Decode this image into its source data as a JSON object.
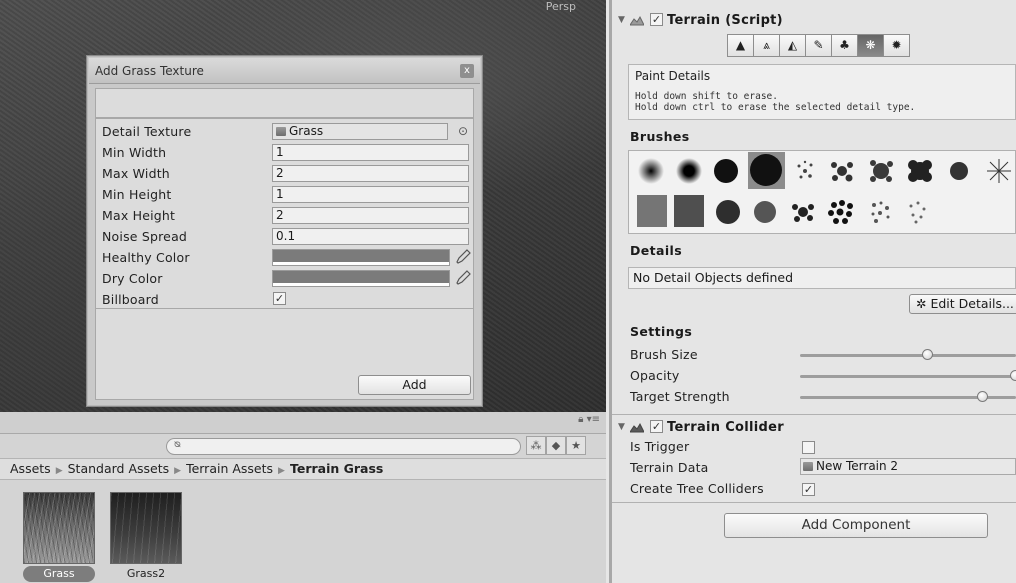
{
  "scene": {
    "view_label": "Persp"
  },
  "dialog": {
    "title": "Add Grass Texture",
    "close_glyph": "x",
    "fields": [
      {
        "label": "Detail Texture",
        "value": "Grass"
      },
      {
        "label": "Min Width",
        "value": "1"
      },
      {
        "label": "Max Width",
        "value": "2"
      },
      {
        "label": "Min Height",
        "value": "1"
      },
      {
        "label": "Max Height",
        "value": "2"
      },
      {
        "label": "Noise Spread",
        "value": "0.1"
      },
      {
        "label": "Healthy Color"
      },
      {
        "label": "Dry Color"
      },
      {
        "label": "Billboard",
        "checked": true
      }
    ],
    "add_label": "Add"
  },
  "project": {
    "breadcrumb": [
      "Assets",
      "Standard Assets",
      "Terrain Assets",
      "Terrain Grass"
    ],
    "assets": [
      {
        "name": "Grass",
        "selected": true
      },
      {
        "name": "Grass2",
        "selected": false
      }
    ]
  },
  "inspector": {
    "terrain_title": "Terrain (Script)",
    "tools": [
      "raise-lower-icon",
      "paint-height-icon",
      "smooth-height-icon",
      "paint-texture-icon",
      "place-trees-icon",
      "paint-details-icon",
      "settings-icon"
    ],
    "active_tool": "paint-details-icon",
    "help": {
      "title": "Paint Details",
      "line1": "Hold down shift to erase.",
      "line2": "Hold down ctrl to erase the selected detail type."
    },
    "brushes_title": "Brushes",
    "details_title": "Details",
    "details_empty": "No Detail Objects defined",
    "edit_details_label": "Edit Details...",
    "settings_title": "Settings",
    "sliders": [
      {
        "label": "Brush Size",
        "value": 0.59
      },
      {
        "label": "Opacity",
        "value": 1.0
      },
      {
        "label": "Target Strength",
        "value": 0.91
      }
    ],
    "collider_title": "Terrain Collider",
    "collider_rows": [
      {
        "label": "Is Trigger",
        "checked": false
      },
      {
        "label": "Terrain Data",
        "value": "New Terrain 2"
      },
      {
        "label": "Create Tree Colliders",
        "checked": true
      }
    ],
    "add_component_label": "Add Component"
  }
}
